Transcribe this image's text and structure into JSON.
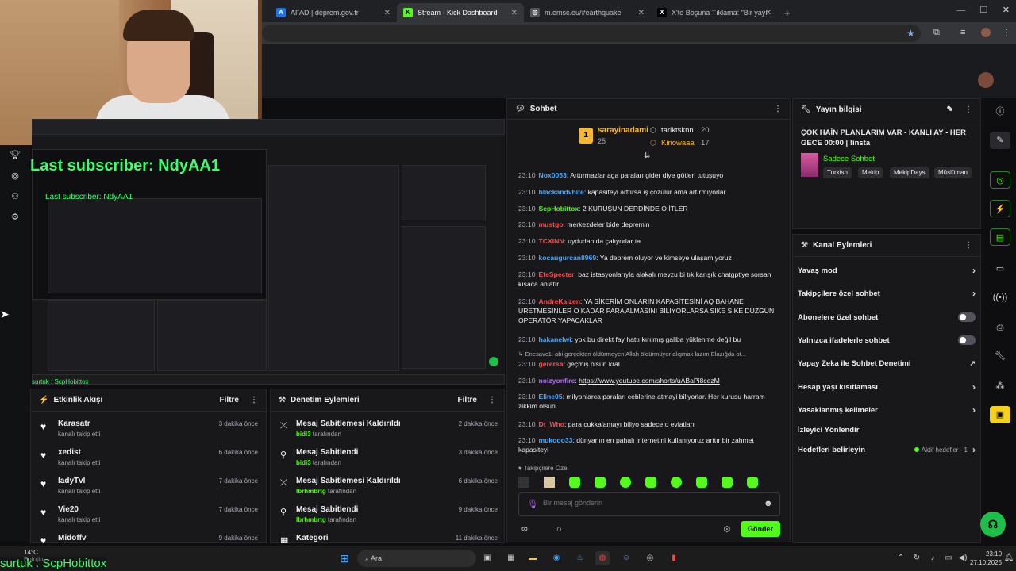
{
  "browser": {
    "tabs": [
      {
        "label": "AFAD | deprem.gov.tr",
        "icon": "afad-icon"
      },
      {
        "label": "Stream - Kick Dashboard",
        "icon": "kick-icon",
        "active": true
      },
      {
        "label": "m.emsc.eu/#earthquake",
        "icon": "globe-icon"
      },
      {
        "label": "X'te Boşuna Tıklama: \"Bir yayın",
        "icon": "x-icon"
      }
    ]
  },
  "overlay": {
    "last_subscriber": "Last subscriber: NdyAA1",
    "last_subscriber_small": "Last subscriber: NdyAA1",
    "sub_bar": "surtuk : ScpHobittox",
    "sub_bar_small": "surtuk : ScpHobittox"
  },
  "activity": {
    "title": "Etkinlik Akışı",
    "filter": "Filtre",
    "items": [
      {
        "name": "Karasatr",
        "action": "kanalı takip etti",
        "time": "3 dakika önce"
      },
      {
        "name": "xedist",
        "action": "kanalı takip etti",
        "time": "6 dakika önce"
      },
      {
        "name": "ladyTvl",
        "action": "kanalı takip etti",
        "time": "7 dakika önce"
      },
      {
        "name": "Vie20",
        "action": "kanalı takip etti",
        "time": "7 dakika önce"
      },
      {
        "name": "Midoffv",
        "action": "",
        "time": "9 dakika önce"
      }
    ]
  },
  "moderation": {
    "title": "Denetim Eylemleri",
    "filter": "Filtre",
    "items": [
      {
        "title": "Mesaj Sabitlemesi Kaldırıldı",
        "by": "bidi3",
        "suffix": "tarafından",
        "time": "2 dakika önce",
        "icon": "unpin-icon"
      },
      {
        "title": "Mesaj Sabitlendi",
        "by": "bidi3",
        "suffix": "tarafından",
        "time": "3 dakika önce",
        "icon": "pin-icon"
      },
      {
        "title": "Mesaj Sabitlemesi Kaldırıldı",
        "by": "lbrhmbrtg",
        "suffix": "tarafından",
        "time": "6 dakika önce",
        "icon": "unpin-icon"
      },
      {
        "title": "Mesaj Sabitlendi",
        "by": "lbrhmbrtg",
        "suffix": "tarafından",
        "time": "9 dakika önce",
        "icon": "pin-icon"
      },
      {
        "title": "Kategori",
        "by": "",
        "suffix": "",
        "time": "11 dakika önce",
        "icon": "category-icon"
      }
    ]
  },
  "chat": {
    "title": "Sohbet",
    "leaderboard": [
      {
        "name": "sarayinadami",
        "count": "25",
        "rank": "1"
      },
      {
        "name": "tariktsknn",
        "count": "20"
      },
      {
        "name": "Kinowaaa",
        "count": "17"
      }
    ],
    "messages": [
      {
        "time": "23:10",
        "user": "Nox0053",
        "color": "#4aa8ff",
        "text": "Arttırmazlar aga paraları gider diye götleri tutuşuyo"
      },
      {
        "time": "23:10",
        "user": "blackandvhite",
        "color": "#4aa8ff",
        "text": "kapasiteyi arttırsa iş çözülür ama artırmıyorlar"
      },
      {
        "time": "23:10",
        "user": "ScpHobittox",
        "color": "#53fc18",
        "text": "2 KURUŞUN DERDİNDE O İTLER"
      },
      {
        "time": "23:10",
        "user": "mustgo",
        "color": "#ff4d4d",
        "text": "merkezdeler bide depremin"
      },
      {
        "time": "23:10",
        "user": "TCXINN",
        "color": "#ff4d4d",
        "text": "uydudan da çalıyorlar ta"
      },
      {
        "time": "23:10",
        "user": "kocaugurcan8969",
        "color": "#4aa8ff",
        "text": "Ya deprem oluyor ve kimseye ulaşamıyoruz"
      },
      {
        "time": "23:10",
        "user": "EfeSpecter",
        "color": "#ff4d4d",
        "text": "baz istasyonlarıyla alakalı mevzu bi tık karışık chatgpt'ye sorsan kısaca anlatır"
      },
      {
        "time": "23:10",
        "user": "AndreKaizen",
        "color": "#ff4d4d",
        "text": "YA SİKERİM ONLARIN KAPASİTESİNİ AQ BAHANE ÜRETMESİNLER O KADAR PARA ALMASINI BİLİYORLARSA SİKE SİKE DÜZGÜN OPERATÖR YAPACAKLAR"
      },
      {
        "time": "23:10",
        "user": "hakanelwi",
        "color": "#4aa8ff",
        "text": "yok bu direkt fay hattı kırılmış galiba yüklenme değil bu"
      },
      {
        "reply": "Enesavc1: abi gerçekten öldürmeyen Allah öldürmüyor alışmak lazım Elazığda ot..."
      },
      {
        "time": "23:10",
        "user": "gerersa",
        "color": "#ff4d4d",
        "text": "geçmiş olsun kral"
      },
      {
        "time": "23:10",
        "user": "noizyonfire",
        "color": "#b36bff",
        "text": "https://www.youtube.com/shorts/uABaPi8cezM",
        "link": true
      },
      {
        "time": "23:10",
        "user": "Eline05",
        "color": "#4aa8ff",
        "text": "milyonlarca paraları ceblerine atmayi biliyorlar. Her kurusu harram zikkim olsun."
      },
      {
        "time": "23:10",
        "user": "Dt_Who",
        "color": "#ff4d4d",
        "text": "para cukkalamayı biliyo sadece o evlatları"
      },
      {
        "time": "23:10",
        "user": "mukooo33",
        "color": "#4aa8ff",
        "text": "dünyanın en pahalı internetini kullanıyoruz arttır bir zahmet kapasiteyi"
      }
    ],
    "followers_label": "Takipçilere Özel",
    "input_placeholder": "Bir mesaj gönderin",
    "send": "Gönder"
  },
  "stream_info": {
    "title": "Yayın bilgisi",
    "stream_title": "ÇOK HAİN PLANLARIM VAR - KANLI AY - HER GECE 00:00 | !insta",
    "category": "Sadece Sohbet",
    "tags": [
      "Turkish",
      "Mekip",
      "MekipDays",
      "Müslüman"
    ]
  },
  "channel_actions": {
    "title": "Kanal Eylemleri",
    "items": [
      {
        "label": "Yavaş mod",
        "kind": "chevron"
      },
      {
        "label": "Takipçilere özel sohbet",
        "kind": "chevron"
      },
      {
        "label": "Abonelere özel sohbet",
        "kind": "toggle"
      },
      {
        "label": "Yalnızca ifadelerle sohbet",
        "kind": "toggle"
      },
      {
        "label": "Yapay Zeka ile Sohbet Denetimi",
        "kind": "external"
      },
      {
        "label": "Hesap yaşı kısıtlaması",
        "kind": "chevron"
      },
      {
        "label": "Yasaklanmış kelimeler",
        "kind": "chevron"
      },
      {
        "label": "İzleyici Yönlendir",
        "kind": "none"
      },
      {
        "label": "Hedefleri belirleyin",
        "kind": "goals"
      }
    ],
    "active_goals": "Aktif hedefler - 1"
  },
  "taskbar": {
    "weather_temp": "14°C",
    "weather_desc": "Bulutlu",
    "search": "Ara",
    "time": "23:10",
    "date": "27.10.2025"
  },
  "colors": {
    "accent": "#53fc18",
    "panel": "#18181b",
    "bg": "#0e0e10"
  }
}
